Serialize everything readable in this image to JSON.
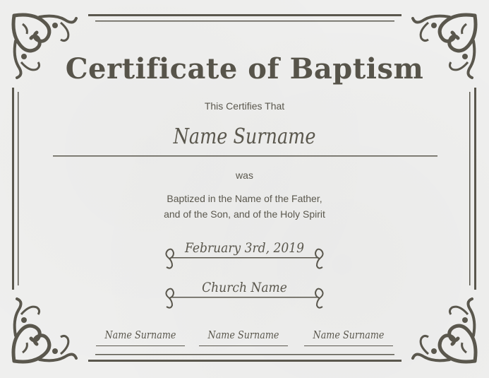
{
  "certificate": {
    "title": "Certificate of Baptism",
    "certifies": "This Certifies That",
    "recipient_name": "Name Surname",
    "was": "was",
    "body_line1": "Baptized in the Name of the Father,",
    "body_line2": "and of the Son, and of the Holy Spirit",
    "date": "February 3rd, 2019",
    "church_name": "Church Name",
    "signatures": [
      "Name Surname",
      "Name Surname",
      "Name Surname"
    ]
  },
  "colors": {
    "ink": "#5a574d",
    "paper": "#efefee"
  },
  "ornaments": [
    "corner-flourish-icon",
    "scroll-divider-icon"
  ]
}
